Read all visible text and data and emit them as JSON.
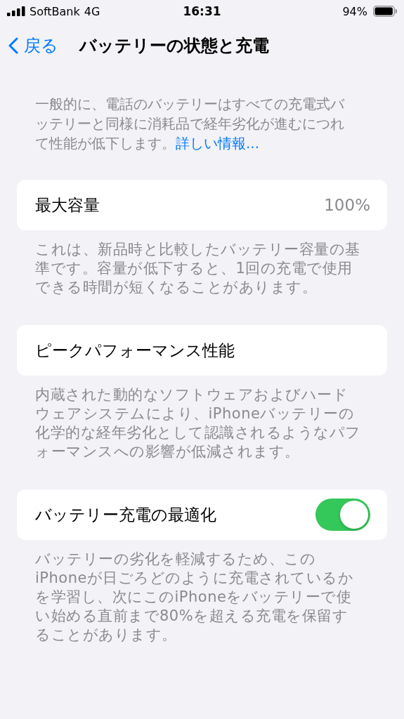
{
  "status_bar": {
    "carrier": "SoftBank",
    "network": "4G",
    "time": "16:31",
    "battery": "94%"
  },
  "nav": {
    "back": "戻る",
    "title": "バッテリーの状態と充電"
  },
  "intro": {
    "text": "一般的に、電話のバッテリーはすべての充電式バッテリーと同様に消耗品で経年劣化が進むにつれて性能が低下します。",
    "link": "詳しい情報..."
  },
  "sections": [
    {
      "kind": "value",
      "label": "最大容量",
      "value": "100%",
      "footer": "これは、新品時と比較したバッテリー容量の基準です。容量が低下すると、1回の充電で使用できる時間が短くなることがあります。"
    },
    {
      "kind": "plain",
      "label": "ピークパフォーマンス性能",
      "footer": "内蔵された動的なソフトウェアおよびハードウェアシステムにより、iPhoneバッテリーの化学的な経年劣化として認識されるようなパフォーマンスへの影響が低減されます。"
    },
    {
      "kind": "toggle",
      "label": "バッテリー充電の最適化",
      "on": true,
      "footer": "バッテリーの劣化を軽減するため、このiPhoneが日ごろどのように充電されているかを学習し、次にこのiPhoneをバッテリーで使い始める直前まで80%を超える充電を保留することがあります。"
    }
  ]
}
